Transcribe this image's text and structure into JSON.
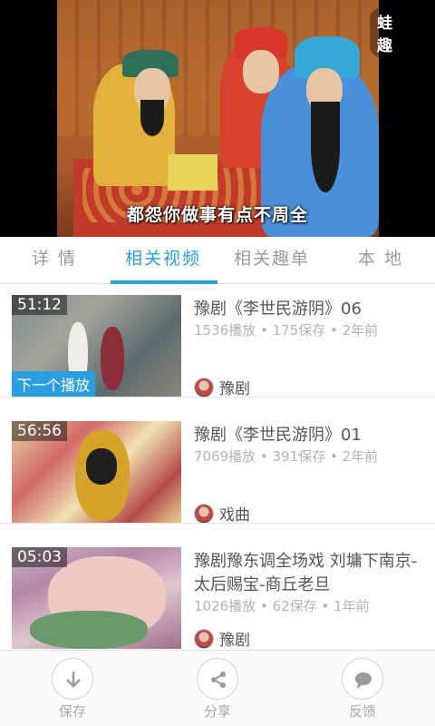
{
  "player": {
    "watermark": "蛙趣",
    "subtitle": "都怨你做事有点不周全"
  },
  "tabs": [
    {
      "label": "详 情",
      "active": false
    },
    {
      "label": "相关视频",
      "active": true
    },
    {
      "label": "相关趣单",
      "active": false
    },
    {
      "label": "本 地",
      "active": false
    }
  ],
  "videos": [
    {
      "duration": "51:12",
      "badge": "下一个播放",
      "title": "豫剧《李世民游阴》06",
      "meta": "1536播放 • 175保存 • 2年前",
      "source": "豫剧"
    },
    {
      "duration": "56:56",
      "title": "豫剧《李世民游阴》01",
      "meta": "7069播放 • 391保存 • 2年前",
      "source": "戏曲"
    },
    {
      "duration": "05:03",
      "title": "豫剧豫东调全场戏 刘墉下南京-太后赐宝-商丘老旦",
      "meta": "1026播放 • 62保存 • 1年前",
      "source": "豫剧"
    }
  ],
  "actions": [
    {
      "label": "保存",
      "icon": "download-icon"
    },
    {
      "label": "分享",
      "icon": "share-icon"
    },
    {
      "label": "反馈",
      "icon": "chat-bubble-icon"
    }
  ],
  "colors": {
    "accent": "#2a9ee0",
    "inactive_tab": "#9a9a9a",
    "meta_text": "#b3b3b3"
  }
}
